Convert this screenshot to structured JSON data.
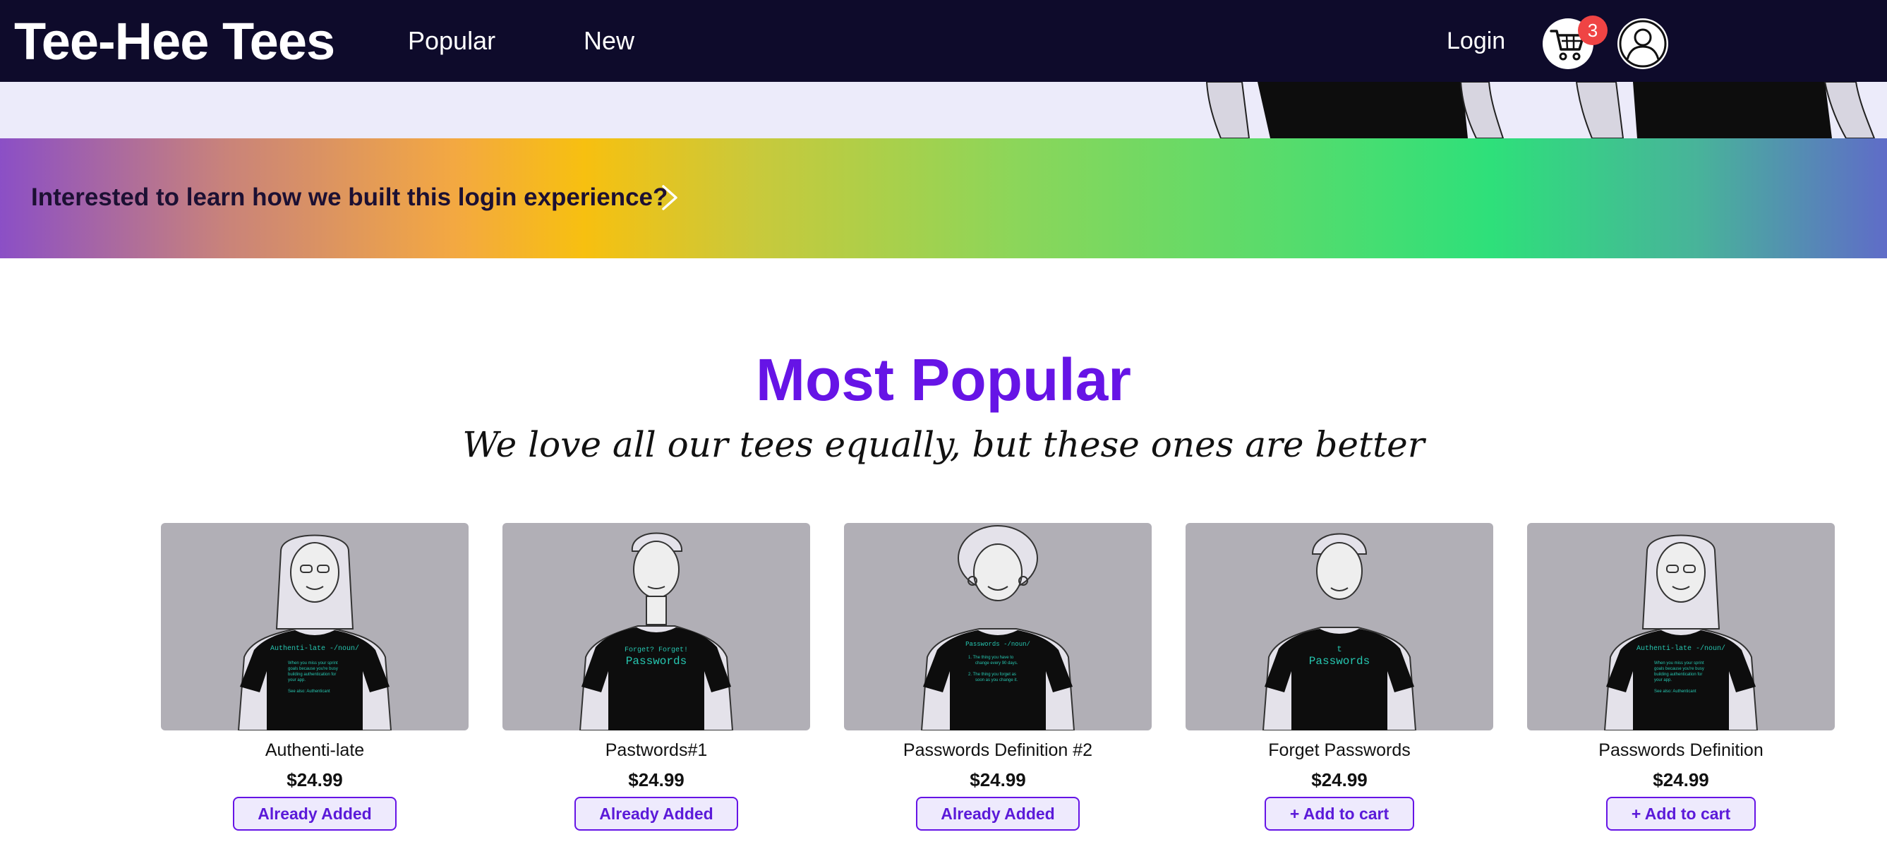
{
  "header": {
    "logo": "Tee-Hee Tees",
    "nav": {
      "popular": "Popular",
      "new": "New"
    },
    "login": "Login",
    "cart_count": "3",
    "icons": {
      "cart": "cart-icon",
      "profile": "user-icon"
    }
  },
  "banner": {
    "text": "Interested to learn how we built this login experience?",
    "icon": "chevron-right-icon"
  },
  "section": {
    "title": "Most Popular",
    "subtitle": "We love all our tees equally, but these ones are better"
  },
  "products": [
    {
      "name": "Authenti-late",
      "price": "$24.99",
      "button": "Already Added",
      "added": true
    },
    {
      "name": "Pastwords#1",
      "price": "$24.99",
      "button": "Already Added",
      "added": true
    },
    {
      "name": "Passwords Definition #2",
      "price": "$24.99",
      "button": "Already Added",
      "added": true
    },
    {
      "name": "Forget Passwords",
      "price": "$24.99",
      "button": "+ Add to cart",
      "added": false
    },
    {
      "name": "Passwords Definition",
      "price": "$24.99",
      "button": "+ Add to cart",
      "added": false
    }
  ],
  "colors": {
    "header_bg": "#0e0b2b",
    "accent": "#6614e6",
    "badge": "#ef4444",
    "card_bg": "#b1afb6"
  }
}
